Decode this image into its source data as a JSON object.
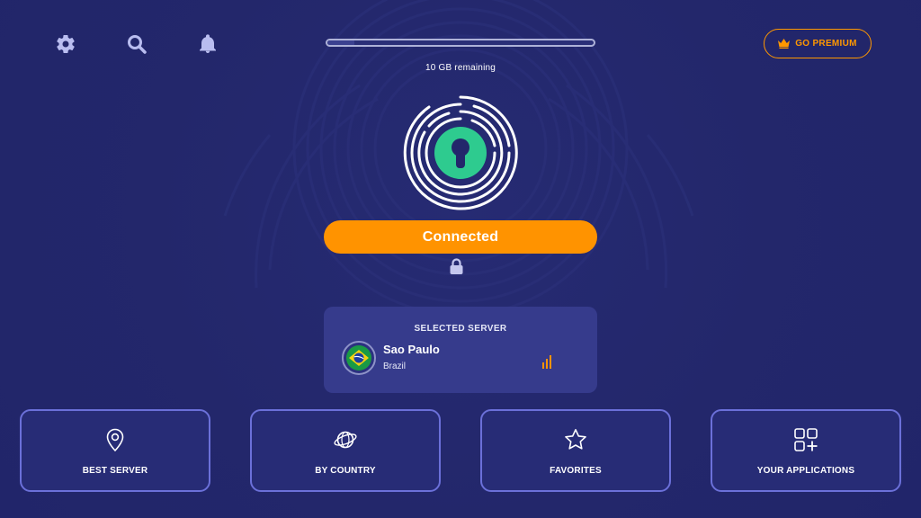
{
  "colors": {
    "background": "#23276b",
    "accent": "#ff9300",
    "card": "#363b8c",
    "tile_border": "#6b70d9",
    "logo_green": "#2ecb8f"
  },
  "toolbar": {
    "icons": [
      "gear-icon",
      "search-icon",
      "bell-icon"
    ]
  },
  "data_usage": {
    "remaining_label": "10 GB remaining",
    "used_fraction": 0.1
  },
  "premium": {
    "label": "GO PREMIUM",
    "icon": "crown-icon"
  },
  "connection": {
    "status_label": "Connected",
    "status_icon": "lock-icon"
  },
  "selected_server": {
    "title": "SELECTED SERVER",
    "city": "Sao Paulo",
    "country": "Brazil",
    "flag_icon": "brazil-flag-icon",
    "signal_icon": "signal-bars-icon"
  },
  "tiles": [
    {
      "label": "BEST SERVER",
      "icon": "location-pin-icon"
    },
    {
      "label": "BY COUNTRY",
      "icon": "globe-orbit-icon"
    },
    {
      "label": "FAVORITES",
      "icon": "star-icon"
    },
    {
      "label": "YOUR APPLICATIONS",
      "icon": "apps-grid-plus-icon"
    }
  ]
}
